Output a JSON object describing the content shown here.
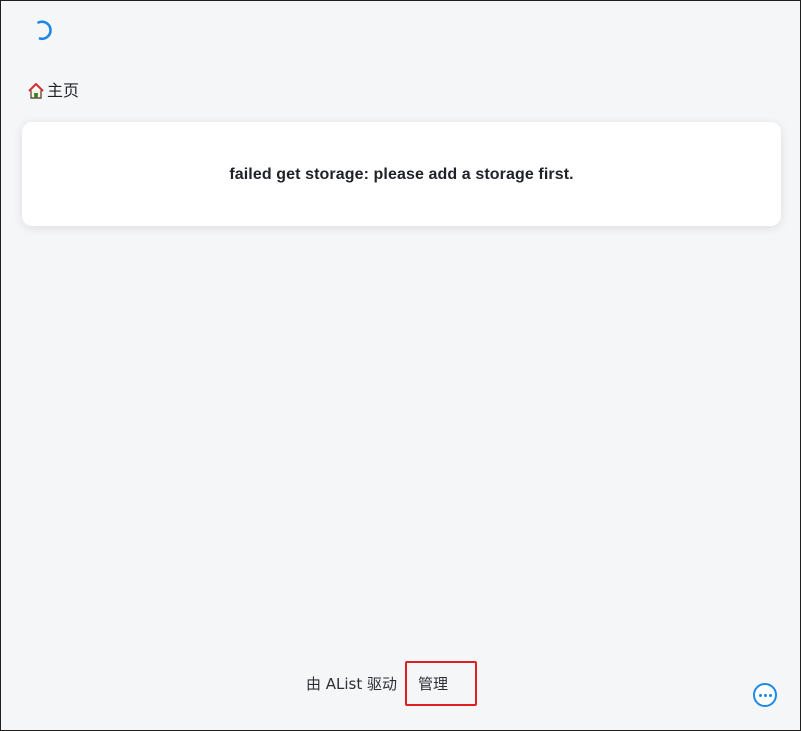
{
  "breadcrumb": {
    "home_label": "主页",
    "home_icon": "home-icon"
  },
  "message": {
    "text": "failed get storage: please add a storage first."
  },
  "footer": {
    "powered_by": "由 AList 驱动",
    "manage_label": "管理"
  },
  "icons": {
    "spinner": "loading-spinner-icon",
    "more": "more-options-icon"
  },
  "colors": {
    "accent": "#1e88e5",
    "highlight_border": "#e02020",
    "background": "#f5f6f8"
  }
}
